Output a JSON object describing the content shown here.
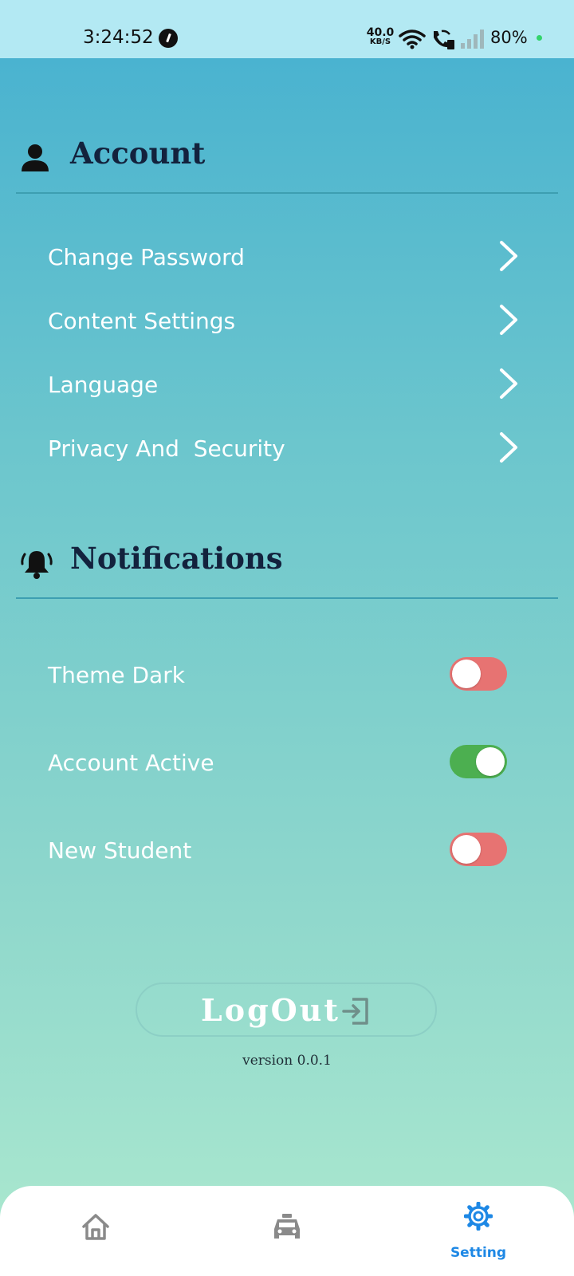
{
  "status_bar": {
    "time": "3:24:52",
    "net_speed_value": "40.0",
    "net_speed_unit": "KB/S",
    "battery": "80%"
  },
  "account": {
    "title": "Account",
    "items": [
      {
        "label": "Change Password"
      },
      {
        "label": "Content Settings"
      },
      {
        "label": "Language"
      },
      {
        "label": "Privacy And  Security"
      }
    ]
  },
  "notifications": {
    "title": "Notifications",
    "toggles": [
      {
        "label": "Theme Dark",
        "state": "off"
      },
      {
        "label": "Account Active",
        "state": "on"
      },
      {
        "label": "New Student",
        "state": "off"
      }
    ]
  },
  "logout": {
    "label": "LogOut"
  },
  "version": "version 0.0.1",
  "bottom_nav": {
    "items": [
      {
        "icon": "home-icon",
        "label": ""
      },
      {
        "icon": "car-icon",
        "label": ""
      },
      {
        "icon": "gear-icon",
        "label": "Setting",
        "active": true
      }
    ]
  },
  "colors": {
    "toggle_off": "#e77372",
    "toggle_on": "#4caf50",
    "active_nav": "#1e88e5",
    "section_title": "#13223d"
  }
}
